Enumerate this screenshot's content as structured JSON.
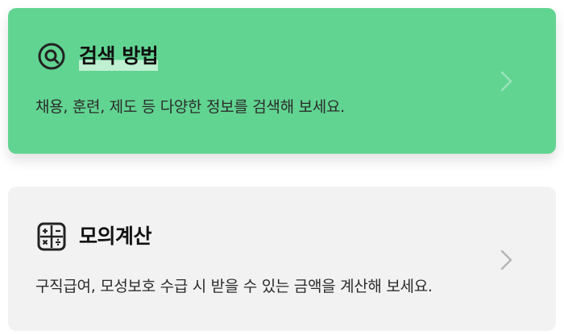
{
  "cards": [
    {
      "title": "검색 방법",
      "description": "채용, 훈련, 제도 등 다양한 정보를 검색해 보세요.",
      "icon": "search-icon",
      "color": "#61d491"
    },
    {
      "title": "모의계산",
      "description": "구직급여, 모성보호 수급 시 받을 수 있는 금액을 계산해 보세요.",
      "icon": "calculator-icon",
      "color": "#f2f2f2"
    }
  ]
}
